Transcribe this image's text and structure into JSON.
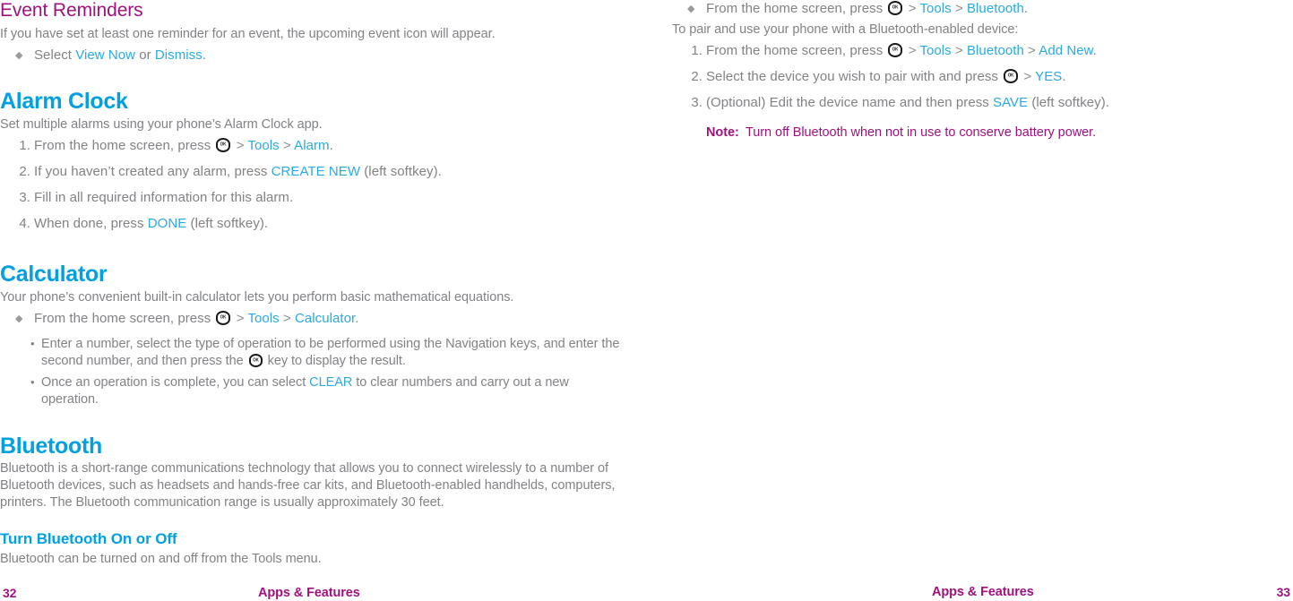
{
  "document": {
    "title": "Apps & Features",
    "left_page_number": "32",
    "right_page_number": "33",
    "colors": {
      "magenta_heading": "#A0117E",
      "blue_heading": "#00A0E2",
      "blue_link": "#29ABE2",
      "body_gray": "#808285"
    }
  },
  "left_column": {
    "event_reminders": {
      "heading": "Event Reminders",
      "intro": "If you have set at least one reminder for an event, the upcoming event icon  will appear.",
      "bullet": {
        "prefix": "Select ",
        "link1": "View Now",
        "mid": " or ",
        "link2": "Dismiss",
        "suffix": "."
      }
    },
    "alarm_clock": {
      "heading": "Alarm Clock",
      "intro": "Set multiple alarms using your phone’s Alarm Clock app.",
      "steps": [
        {
          "num": "1.",
          "prefix": "From the home screen, press ",
          "icon": "ok-key-icon",
          "sep1": " > ",
          "link1": "Tools",
          "sep2": " > ",
          "link2": "Alarm",
          "suffix": "."
        },
        {
          "num": "2.",
          "prefix": "If you haven’t created any alarm, press ",
          "link1": "CREATE NEW",
          "suffix": " (left softkey)."
        },
        {
          "num": "3.",
          "prefix": "Fill in all required information for this alarm.",
          "link1": "",
          "suffix": ""
        },
        {
          "num": "4.",
          "prefix": "When done, press ",
          "link1": "DONE",
          "suffix": " (left softkey)."
        }
      ]
    },
    "calculator": {
      "heading": "Calculator",
      "intro": "Your phone’s convenient built-in calculator lets you perform basic mathematical equations.",
      "bullet": {
        "prefix": "From the home screen, press ",
        "icon": "ok-key-icon",
        "sep1": " > ",
        "link1": "Tools",
        "sep2": " > ",
        "link2": "Calculator",
        "suffix": "."
      },
      "subbullets": [
        {
          "part1": "Enter a number, select the type of operation to be performed using the Navigation keys, and enter the second number, and then press the ",
          "icon": "ok-key-icon",
          "part2": " key to display the result."
        },
        {
          "part1": "Once an operation is complete, you can select ",
          "link": "CLEAR",
          "part2": " to clear numbers and carry out a new operation."
        }
      ]
    },
    "bluetooth": {
      "heading": "Bluetooth",
      "intro": "Bluetooth is a short-range communications technology that allows you to connect wirelessly to a number of Bluetooth devices, such as headsets and hands-free car kits, and Bluetooth-enabled handhelds, computers, printers. The Bluetooth communication range is usually approximately 30 feet.",
      "subheading": "Turn Bluetooth On or Off",
      "subintro": "Bluetooth can be turned on and off from the Tools menu."
    }
  },
  "right_column": {
    "bluetooth_bullet": {
      "prefix": "From the home screen, press ",
      "icon": "ok-key-icon",
      "sep1": " > ",
      "link1": "Tools",
      "sep2": " > ",
      "link2": "Bluetooth",
      "suffix": "."
    },
    "pair_intro": "To pair and use your phone with a Bluetooth-enabled device:",
    "pair_steps": [
      {
        "num": "1.",
        "prefix": "From the home screen, press ",
        "icon": "ok-key-icon",
        "sep1": " > ",
        "link1": "Tools",
        "sep2": " > ",
        "link2": "Bluetooth",
        "sep3": " > ",
        "link3": "Add New",
        "suffix": "."
      },
      {
        "num": "2.",
        "prefix": "Select the device you wish to pair with and press ",
        "icon": "ok-key-icon",
        "sep1": " > ",
        "link1": "YES",
        "suffix": "."
      },
      {
        "num": "3.",
        "prefix": "(Optional) Edit the device name and then press ",
        "link1": "SAVE",
        "suffix": " (left softkey)."
      }
    ],
    "note": {
      "label": "Note:",
      "text": "Turn off Bluetooth when not in use to conserve battery power."
    }
  }
}
